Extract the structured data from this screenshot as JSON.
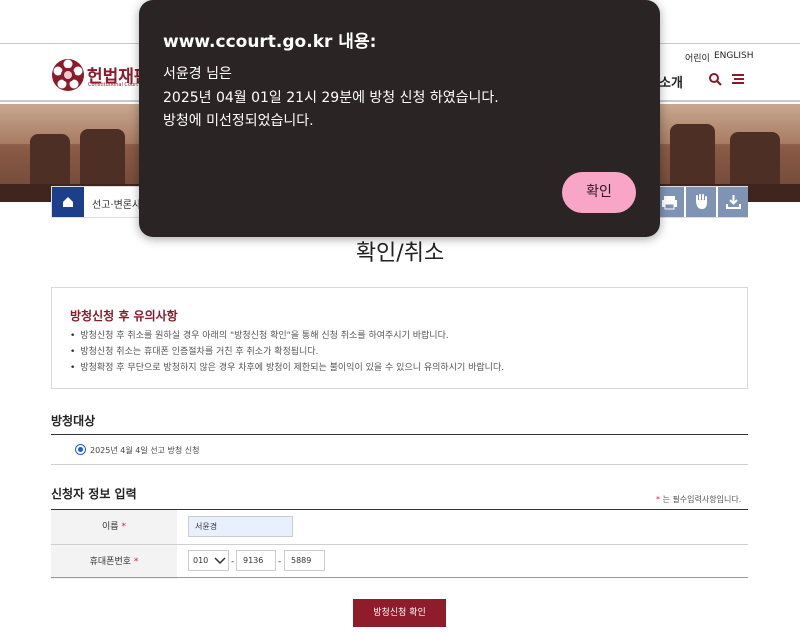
{
  "header": {
    "logo_text": "헌법재판",
    "logo_sub": "Constitutional Court o",
    "util_kids": "어린이",
    "util_english": "ENGLISH",
    "nav_partial": "소개",
    "brand_color": "#8b1a2b"
  },
  "breadcrumb": {
    "text": "선고·변론사"
  },
  "page": {
    "title": "확인/취소"
  },
  "notice": {
    "title": "방청신청 후 유의사항",
    "items": [
      "방청신청 후 취소를 원하실 경우 아래의 \"방청신청 확인\"을 통해 신청 취소를 하여주시기 바랍니다.",
      "방청신청 취소는 휴대폰 인증절차를 거친 후 취소가 확정됩니다.",
      "방청확정 후 무단으로 방청하지 않은 경우 차후에 방청이 제한되는 불이익이 있을 수 있으니 유의하시기 바랍니다."
    ]
  },
  "target": {
    "title": "방청대상",
    "option_label": "2025년 4월 4일 선고 방청 신청"
  },
  "applicant": {
    "title": "신청자 정보 입력",
    "required_note": "는 필수입력사항입니다.",
    "required_star": "*",
    "name_label": "이름",
    "name_value": "서윤경",
    "phone_label": "휴대폰번호",
    "phone_prefix": "010",
    "phone_mid": "9136",
    "phone_last": "5889",
    "dash": "-"
  },
  "submit_label": "방청신청 확인",
  "dialog": {
    "title": "www.ccourt.go.kr 내용:",
    "line1": "서윤경 님은",
    "line2": "2025년 04월 01일 21시 29분에 방청 신청 하였습니다.",
    "line3": "방청에 미선정되었습니다.",
    "ok_label": "확인"
  }
}
